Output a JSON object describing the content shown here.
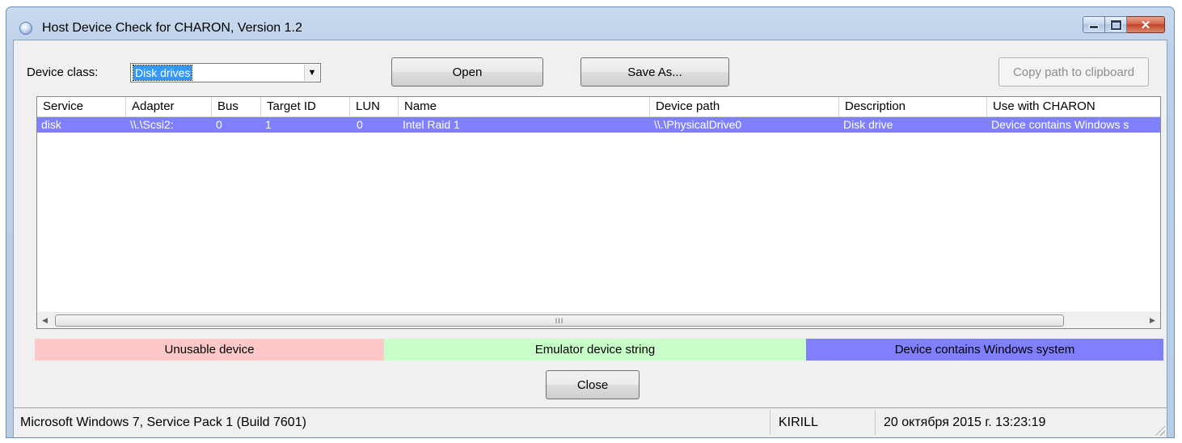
{
  "window": {
    "title": "Host Device Check for CHARON, Version 1.2"
  },
  "toolbar": {
    "device_class_label": "Device class:",
    "device_class_value": "Disk drives",
    "open_label": "Open",
    "save_as_label": "Save As...",
    "copy_label": "Copy path to clipboard"
  },
  "table": {
    "columns": [
      "Service",
      "Adapter",
      "Bus",
      "Target ID",
      "LUN",
      "Name",
      "Device path",
      "Description",
      "Use with CHARON"
    ],
    "rows": [
      [
        "disk",
        "\\\\.\\Scsi2:",
        "0",
        "1",
        "0",
        "Intel Raid 1",
        "\\\\.\\PhysicalDrive0",
        "Disk drive",
        "Device contains Windows s"
      ]
    ],
    "scroll_grip": "III"
  },
  "legend": {
    "unusable": "Unusable device",
    "emulator": "Emulator device string",
    "windows": "Device contains Windows system",
    "colors": {
      "unusable": "#ffc8c8",
      "emulator": "#c8ffc8",
      "windows": "#8080ff"
    }
  },
  "close_label": "Close",
  "statusbar": {
    "os": "Microsoft Windows 7, Service Pack 1 (Build 7601)",
    "user": "KIRILL",
    "datetime": "20 октября 2015 г. 13:23:19"
  }
}
